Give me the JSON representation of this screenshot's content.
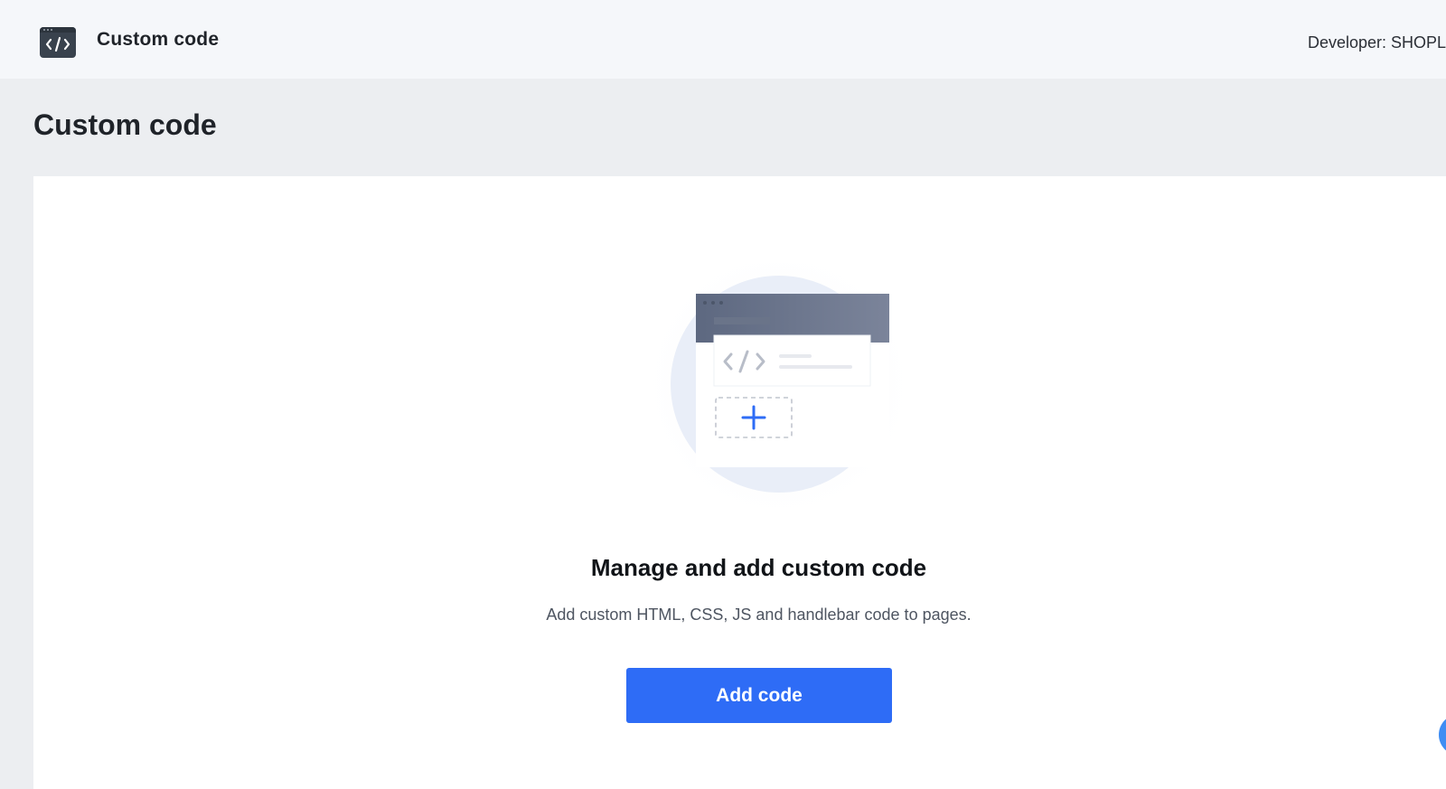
{
  "header": {
    "app_icon": "code-window-icon",
    "app_title": "Custom code",
    "developer_text": "Developer: SHOPL"
  },
  "page": {
    "title": "Custom code"
  },
  "empty_state": {
    "illustration_icon": "code-card-add-illustration",
    "heading": "Manage and add custom code",
    "description": "Add custom HTML, CSS, JS and handlebar code to pages.",
    "primary_button_label": "Add code"
  },
  "colors": {
    "primary": "#2e6cf6",
    "header_bg": "#f5f7fa",
    "page_bg": "#eceef1"
  },
  "floating_action": {
    "icon": "help-chat-icon"
  }
}
